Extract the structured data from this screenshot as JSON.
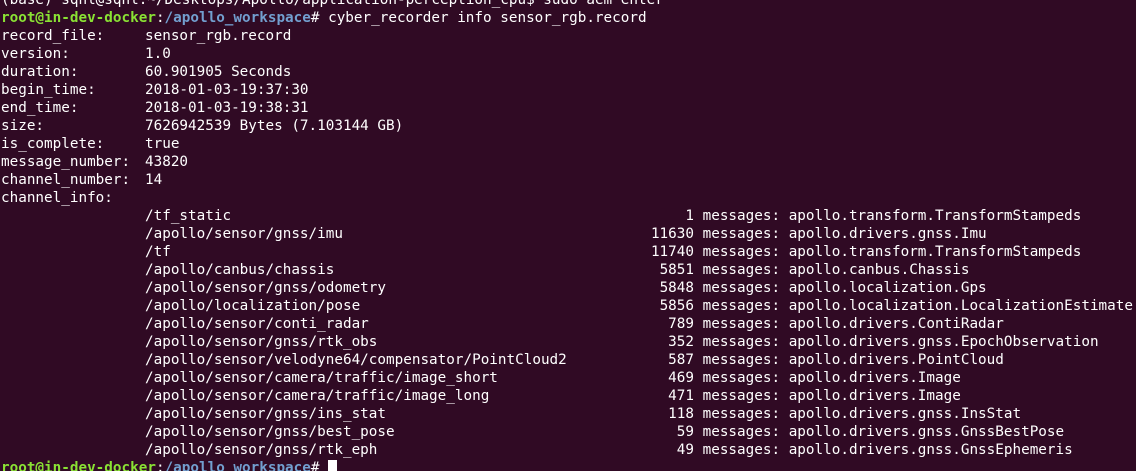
{
  "prev_line": {
    "user": "(base) sqhl@sqhl",
    "sep": ":",
    "path": "~/Desktops/Apollo/application-perception_cpu",
    "rest": "$ sudo aem enter"
  },
  "prompt": {
    "user": "root@in-dev-docker",
    "sep": ":",
    "path": "/apollo_workspace",
    "symbol": "#",
    "command": " cyber_recorder info sensor_rgb.record"
  },
  "info": [
    {
      "key": "record_file:",
      "value": "sensor_rgb.record"
    },
    {
      "key": "version:",
      "value": "1.0"
    },
    {
      "key": "duration:",
      "value": "60.901905 Seconds"
    },
    {
      "key": "begin_time:",
      "value": "2018-01-03-19:37:30"
    },
    {
      "key": "end_time:",
      "value": "2018-01-03-19:38:31"
    },
    {
      "key": "size:",
      "value": "7626942539 Bytes (7.103144 GB)"
    },
    {
      "key": "is_complete:",
      "value": "true"
    },
    {
      "key": "message_number:",
      "value": "43820"
    },
    {
      "key": "channel_number:",
      "value": "14"
    },
    {
      "key": "channel_info:",
      "value": ""
    }
  ],
  "channels": [
    {
      "name": "/tf_static",
      "count": "1",
      "type": "apollo.transform.TransformStampeds"
    },
    {
      "name": "/apollo/sensor/gnss/imu",
      "count": "11630",
      "type": "apollo.drivers.gnss.Imu"
    },
    {
      "name": "/tf",
      "count": "11740",
      "type": "apollo.transform.TransformStampeds"
    },
    {
      "name": "/apollo/canbus/chassis",
      "count": "5851",
      "type": "apollo.canbus.Chassis"
    },
    {
      "name": "/apollo/sensor/gnss/odometry",
      "count": "5848",
      "type": "apollo.localization.Gps"
    },
    {
      "name": "/apollo/localization/pose",
      "count": "5856",
      "type": "apollo.localization.LocalizationEstimate"
    },
    {
      "name": "/apollo/sensor/conti_radar",
      "count": "789",
      "type": "apollo.drivers.ContiRadar"
    },
    {
      "name": "/apollo/sensor/gnss/rtk_obs",
      "count": "352",
      "type": "apollo.drivers.gnss.EpochObservation"
    },
    {
      "name": "/apollo/sensor/velodyne64/compensator/PointCloud2",
      "count": "587",
      "type": "apollo.drivers.PointCloud"
    },
    {
      "name": "/apollo/sensor/camera/traffic/image_short",
      "count": "469",
      "type": "apollo.drivers.Image"
    },
    {
      "name": "/apollo/sensor/camera/traffic/image_long",
      "count": "471",
      "type": "apollo.drivers.Image"
    },
    {
      "name": "/apollo/sensor/gnss/ins_stat",
      "count": "118",
      "type": "apollo.drivers.gnss.InsStat"
    },
    {
      "name": "/apollo/sensor/gnss/best_pose",
      "count": "59",
      "type": "apollo.drivers.gnss.GnssBestPose"
    },
    {
      "name": "/apollo/sensor/gnss/rtk_eph",
      "count": "49",
      "type": "apollo.drivers.gnss.GnssEphemeris"
    }
  ],
  "messages_label": " messages: ",
  "colors": {
    "background": "#300a24",
    "text": "#ffffff",
    "prompt_user": "#8ae234",
    "prompt_path": "#729fcf"
  }
}
